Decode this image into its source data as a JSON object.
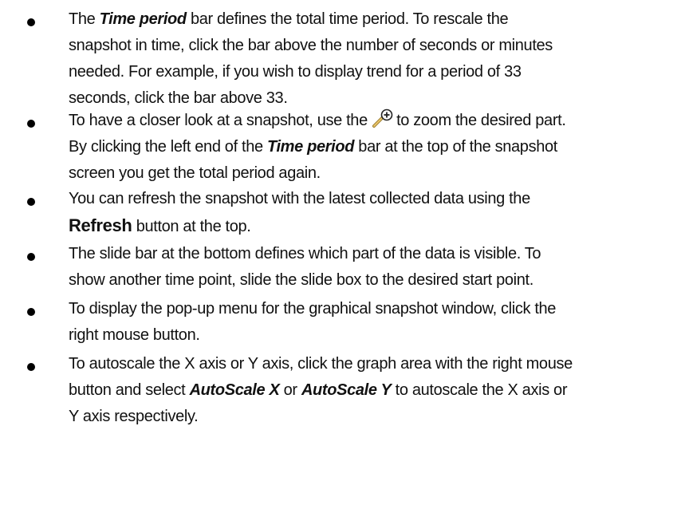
{
  "bullets": [
    {
      "lines": [
        [
          {
            "t": "The "
          },
          {
            "t": "Time period",
            "style": "bi"
          },
          {
            "t": " bar defines the total time period. To rescale the"
          }
        ],
        [
          {
            "t": "snapshot in time, click the bar above the number of seconds or minutes"
          }
        ],
        [
          {
            "t": "needed. For example, if you wish to display trend for a period of 33"
          }
        ],
        [
          {
            "t": "seconds, click the bar above 33."
          }
        ]
      ]
    },
    {
      "lines": [
        [
          {
            "t": "To have a closer look at a snapshot, use the "
          },
          {
            "icon": "zoom-icon"
          },
          {
            "t": "to zoom the desired part."
          }
        ],
        [
          {
            "t": "By clicking  the left end of the "
          },
          {
            "t": "Time period",
            "style": "bi"
          },
          {
            "t": " bar at the top of the snapshot"
          }
        ],
        [
          {
            "t": "screen you get the total period again."
          }
        ]
      ]
    },
    {
      "lines": [
        [
          {
            "t": "You can refresh the snapshot with the latest collected data using the"
          }
        ],
        [
          {
            "t": "Refresh",
            "style": "big"
          },
          {
            "t": " button at the top."
          }
        ]
      ]
    },
    {
      "lines": [
        [
          {
            "t": "The slide bar at the bottom defines which part of the data is visible. To"
          }
        ],
        [
          {
            "t": "show another time point, slide the slide box to the desired start point."
          }
        ]
      ]
    },
    {
      "lines": [
        [
          {
            "t": "To display the pop-up menu for the graphical snapshot window, click the"
          }
        ],
        [
          {
            "t": "right mouse button."
          }
        ]
      ]
    },
    {
      "lines": [
        [
          {
            "t": "To autoscale the X axis or Y axis, click the graph area with the right mouse"
          }
        ],
        [
          {
            "t": "button and select "
          },
          {
            "t": "AutoScale X",
            "style": "bi"
          },
          {
            "t": " or "
          },
          {
            "t": "AutoScale Y",
            "style": "bi"
          },
          {
            "t": "  to autoscale the X axis or"
          }
        ],
        [
          {
            "t": "Y axis respectively."
          }
        ]
      ]
    }
  ]
}
